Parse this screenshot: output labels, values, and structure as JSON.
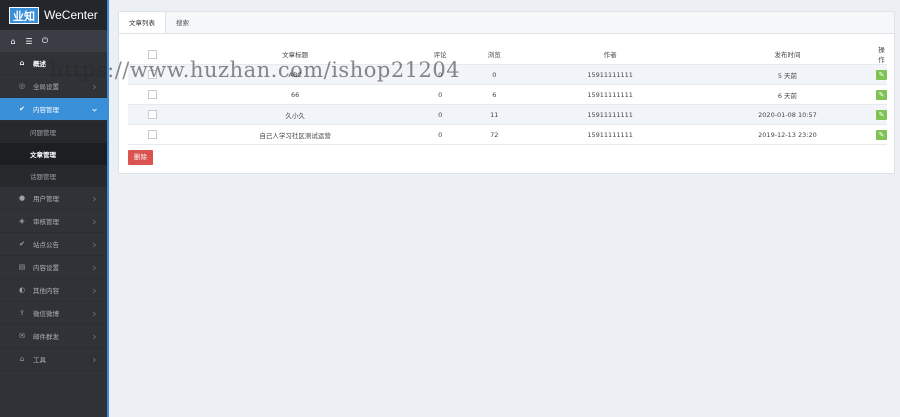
{
  "app": {
    "logo_badge": "业知",
    "logo_text": "WeCenter"
  },
  "quickbar": [
    {
      "icon": "home-icon",
      "glyph": "⌂"
    },
    {
      "icon": "list-icon",
      "glyph": "☰"
    },
    {
      "icon": "power-icon",
      "glyph": "⏻"
    }
  ],
  "sidebar": {
    "items": [
      {
        "label": "概述",
        "icon": "home-icon",
        "glyph": "⌂",
        "state": "home"
      },
      {
        "label": "全局设置",
        "icon": "settings-icon",
        "glyph": "◎",
        "chevron": true
      },
      {
        "label": "内容管理",
        "icon": "content-icon",
        "glyph": "✔",
        "state": "active",
        "chevron": true,
        "expanded": true
      },
      {
        "label": "问题管理",
        "sub": true
      },
      {
        "label": "文章管理",
        "sub": true,
        "state": "current"
      },
      {
        "label": "话题管理",
        "sub": true
      },
      {
        "label": "用户管理",
        "icon": "user-icon",
        "glyph": "●",
        "chevron": true
      },
      {
        "label": "审核管理",
        "icon": "shield-icon",
        "glyph": "◈",
        "chevron": true
      },
      {
        "label": "站点公告",
        "icon": "notice-icon",
        "glyph": "✔",
        "chevron": true
      },
      {
        "label": "内容设置",
        "icon": "document-icon",
        "glyph": "▤",
        "chevron": true
      },
      {
        "label": "其他内容",
        "icon": "pie-icon",
        "glyph": "◐",
        "chevron": true
      },
      {
        "label": "微信微博",
        "icon": "share-icon",
        "glyph": "⇪",
        "chevron": true
      },
      {
        "label": "邮件群发",
        "icon": "mail-icon",
        "glyph": "✉",
        "chevron": true
      },
      {
        "label": "工具",
        "icon": "tools-icon",
        "glyph": "⌂",
        "chevron": true
      }
    ]
  },
  "tabs": [
    {
      "label": "文章列表",
      "active": true
    },
    {
      "label": "搜索"
    }
  ],
  "table": {
    "headers": [
      "",
      "文章标题",
      "评论",
      "浏览",
      "作者",
      "发布时间",
      "操作"
    ],
    "rows": [
      {
        "title": "ABC",
        "comments": "0",
        "views": "0",
        "author": "15911111111",
        "time": "5 天前"
      },
      {
        "title": "66",
        "comments": "0",
        "views": "6",
        "author": "15911111111",
        "time": "6 天前"
      },
      {
        "title": "久小久",
        "comments": "0",
        "views": "11",
        "author": "15911111111",
        "time": "2020-01-08 10:57"
      },
      {
        "title": "自己人学习社区测试运营",
        "comments": "0",
        "views": "72",
        "author": "15911111111",
        "time": "2019-12-13 23:20"
      }
    ]
  },
  "delete_label": "删除",
  "watermark": "https://www.huzhan.com/ishop21204",
  "colors": {
    "accent": "#3a8fd9",
    "edit": "#7ec353",
    "danger": "#d9534f",
    "sidebar": "#2f3236"
  }
}
